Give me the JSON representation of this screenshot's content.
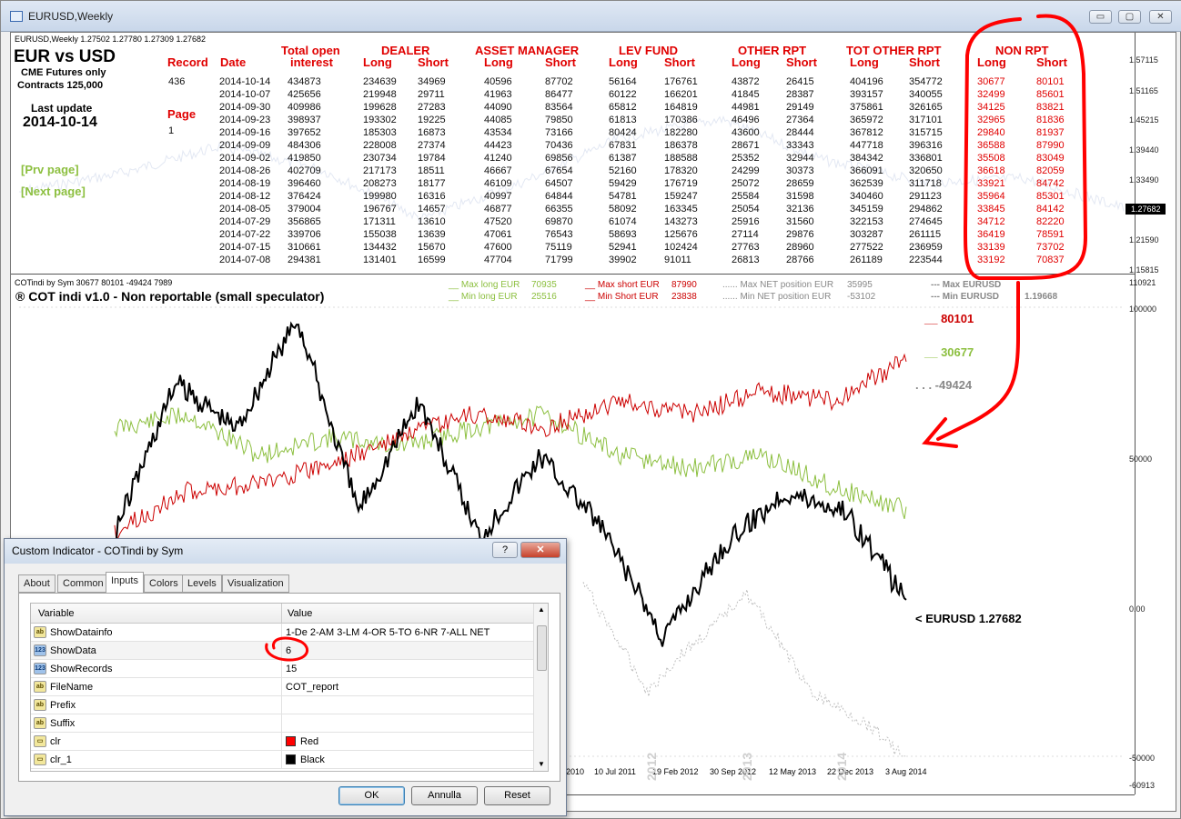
{
  "window": {
    "title": "EURUSD,Weekly",
    "buttons": {
      "minimize": "▭",
      "restore": "▢",
      "close": "✕"
    }
  },
  "chart": {
    "symbol_line": "EURUSD,Weekly  1.27502 1.27780 1.27309 1.27682",
    "heading": "EUR vs USD",
    "sub1": "CME Futures only",
    "sub2": "Contracts 125,000",
    "last_update_label": "Last update",
    "last_update": "2014-10-14",
    "record_label": "Record",
    "record_value": "436",
    "page_label": "Page",
    "page_value": "1",
    "prev_page": "[Prv page]",
    "next_page": "[Next page]",
    "col_headers": {
      "date": "Date",
      "total_open1": "Total open",
      "total_open2": "interest",
      "dealer": "DEALER",
      "asset_manager": "ASSET MANAGER",
      "lev_fund": "LEV FUND",
      "other_rpt": "OTHER RPT",
      "tot_other_rpt": "TOT OTHER RPT",
      "non_rpt": "NON RPT",
      "long": "Long",
      "short": "Short"
    },
    "rows": [
      [
        "2014-10-14",
        "434873",
        "234639",
        "34969",
        "40596",
        "87702",
        "56164",
        "176761",
        "43872",
        "26415",
        "404196",
        "354772",
        "30677",
        "80101"
      ],
      [
        "2014-10-07",
        "425656",
        "219948",
        "29711",
        "41963",
        "86477",
        "60122",
        "166201",
        "41845",
        "28387",
        "393157",
        "340055",
        "32499",
        "85601"
      ],
      [
        "2014-09-30",
        "409986",
        "199628",
        "27283",
        "44090",
        "83564",
        "65812",
        "164819",
        "44981",
        "29149",
        "375861",
        "326165",
        "34125",
        "83821"
      ],
      [
        "2014-09-23",
        "398937",
        "193302",
        "19225",
        "44085",
        "79850",
        "61813",
        "170386",
        "46496",
        "27364",
        "365972",
        "317101",
        "32965",
        "81836"
      ],
      [
        "2014-09-16",
        "397652",
        "185303",
        "16873",
        "43534",
        "73166",
        "80424",
        "182280",
        "43600",
        "28444",
        "367812",
        "315715",
        "29840",
        "81937"
      ],
      [
        "2014-09-09",
        "484306",
        "228008",
        "27374",
        "44423",
        "70436",
        "67831",
        "186378",
        "28671",
        "33343",
        "447718",
        "396316",
        "36588",
        "87990"
      ],
      [
        "2014-09-02",
        "419850",
        "230734",
        "19784",
        "41240",
        "69856",
        "61387",
        "188588",
        "25352",
        "32944",
        "384342",
        "336801",
        "35508",
        "83049"
      ],
      [
        "2014-08-26",
        "402709",
        "217173",
        "18511",
        "46667",
        "67654",
        "52160",
        "178320",
        "24299",
        "30373",
        "366091",
        "320650",
        "36618",
        "82059"
      ],
      [
        "2014-08-19",
        "396460",
        "208273",
        "18177",
        "46109",
        "64507",
        "59429",
        "176719",
        "25072",
        "28659",
        "362539",
        "311718",
        "33921",
        "84742"
      ],
      [
        "2014-08-12",
        "376424",
        "199980",
        "16316",
        "40997",
        "64844",
        "54781",
        "159247",
        "25584",
        "31598",
        "340460",
        "291123",
        "35964",
        "85301"
      ],
      [
        "2014-08-05",
        "379004",
        "196767",
        "14657",
        "46877",
        "66355",
        "58092",
        "163345",
        "25054",
        "32136",
        "345159",
        "294862",
        "33845",
        "84142"
      ],
      [
        "2014-07-29",
        "356865",
        "171311",
        "13610",
        "47520",
        "69870",
        "61074",
        "143273",
        "25916",
        "31560",
        "322153",
        "274645",
        "34712",
        "82220"
      ],
      [
        "2014-07-22",
        "339706",
        "155038",
        "13639",
        "47061",
        "76543",
        "58693",
        "125676",
        "27114",
        "29876",
        "303287",
        "261115",
        "36419",
        "78591"
      ],
      [
        "2014-07-15",
        "310661",
        "134432",
        "15670",
        "47600",
        "75119",
        "52941",
        "102424",
        "27763",
        "28960",
        "277522",
        "236959",
        "33139",
        "73702"
      ],
      [
        "2014-07-08",
        "294381",
        "131401",
        "16599",
        "47704",
        "71799",
        "39902",
        "91011",
        "26813",
        "28766",
        "261189",
        "223544",
        "33192",
        "70837"
      ]
    ],
    "price_scale": [
      "1.57115",
      "1.51165",
      "1.45215",
      "1.39440",
      "1.33490",
      "1.27682",
      "1.21590",
      "1.15815"
    ],
    "indicator_scale": [
      "110921",
      "100000",
      "50000",
      "0.00",
      "-50000",
      "-60913"
    ],
    "x_axis": [
      "2010",
      "10 Jul 2011",
      "19 Feb 2012",
      "30 Sep 2012",
      "12 May 2013",
      "22 Dec 2013",
      "3 Aug 2014"
    ],
    "years": [
      "2012",
      "2013",
      "2014"
    ]
  },
  "indicator": {
    "info_line": "COTindi by Sym 30677 80101 -49424 7989",
    "title": "® COT indi v1.0 - Non reportable (small speculator)",
    "max_long_label": "__ Max long EUR",
    "max_long_value": "70935",
    "min_long_label": "__ Min long EUR",
    "min_long_value": "25516",
    "max_short_label": "__ Max short EUR",
    "max_short_value": "87990",
    "min_short_label": "__ Min Short EUR",
    "min_short_value": "23838",
    "max_net_label": "...... Max NET position EUR",
    "max_net_value": "35995",
    "min_net_label": "...... Min NET position EUR",
    "min_net_value": "-53102",
    "max_eurusd_label": "--- Max EURUSD",
    "min_eurusd_label": "--- Min EURUSD",
    "min_eurusd_value": "1.19668",
    "short_tag": "__ 80101",
    "long_tag": "__ 30677",
    "net_tag": ". . . -49424",
    "eurusd_tag": "< EURUSD  1.27682",
    "colors": {
      "long": "#8cbf3f",
      "short": "#cc0000",
      "eurusd": "#000000",
      "net": "#bbbbbb",
      "annotation": "#ff0000"
    }
  },
  "dialog": {
    "title": "Custom Indicator - COTindi by Sym",
    "help": "?",
    "close": "✕",
    "tabs": [
      "About",
      "Common",
      "Inputs",
      "Colors",
      "Levels",
      "Visualization"
    ],
    "active_tab": "Inputs",
    "col_variable": "Variable",
    "col_value": "Value",
    "params": [
      {
        "icon": "ab",
        "name": "ShowDatainfo",
        "value": "1-De  2-AM  3-LM  4-OR  5-TO  6-NR  7-ALL NET"
      },
      {
        "icon": "123",
        "name": "ShowData",
        "value": "6"
      },
      {
        "icon": "123",
        "name": "ShowRecords",
        "value": "15"
      },
      {
        "icon": "ab",
        "name": "FileName",
        "value": "COT_report"
      },
      {
        "icon": "ab",
        "name": "Prefix",
        "value": ""
      },
      {
        "icon": "ab",
        "name": "Suffix",
        "value": ""
      },
      {
        "icon": "clr",
        "name": "clr",
        "value": "Red",
        "swatch": "#ff0000"
      },
      {
        "icon": "clr",
        "name": "clr_1",
        "value": "Black",
        "swatch": "#000000"
      }
    ],
    "ok": "OK",
    "cancel": "Annulla",
    "reset": "Reset"
  }
}
